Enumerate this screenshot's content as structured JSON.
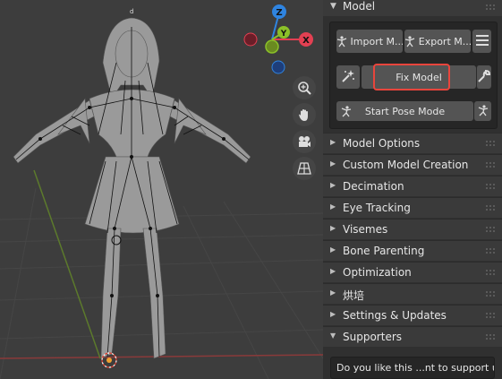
{
  "panel": {
    "header_title": "Model",
    "buttons": {
      "import": "Import M...",
      "export": "Export M...",
      "fix_model": "Fix Model",
      "start_pose": "Start Pose Mode"
    },
    "sections": [
      "Model Options",
      "Custom Model Creation",
      "Decimation",
      "Eye Tracking",
      "Visemes",
      "Bone Parenting",
      "Optimization",
      "烘培",
      "Settings & Updates",
      "Supporters"
    ],
    "supporters_text": "Do you like this ...nt to support us?"
  },
  "gizmo": {
    "z": "Z",
    "y": "Y",
    "x": "X",
    "colors": {
      "x": "#e34052",
      "y": "#8bc028",
      "z": "#2f84e0"
    }
  },
  "colors": {
    "highlight": "#e8453c",
    "panel_bg": "#303030",
    "button": "#545454"
  }
}
